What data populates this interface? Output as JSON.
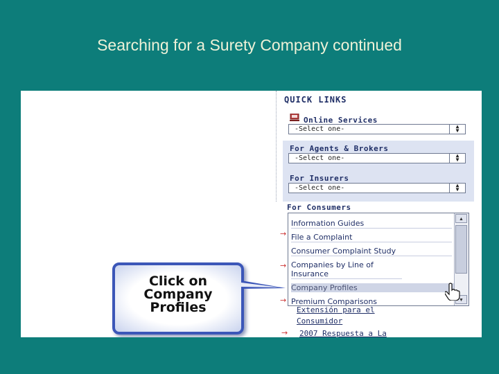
{
  "slide": {
    "title": "Searching for a Surety Company continued"
  },
  "quick_links": {
    "heading": "QUICK LINKS",
    "online_services": {
      "label": "Online Services",
      "selected": "-Select one-"
    },
    "agents_brokers": {
      "label": "For Agents & Brokers",
      "selected": "-Select one-"
    },
    "insurers": {
      "label": "For Insurers",
      "selected": "-Select one-"
    },
    "consumers": {
      "label": "For Consumers",
      "options": [
        "Information Guides",
        "File a Complaint",
        "Consumer Complaint Study",
        "Companies by Line of Insurance",
        "Company Profiles",
        "Premium Comparisons"
      ],
      "highlighted": "Company Profiles"
    }
  },
  "links_below": [
    "Extensión para el",
    "Consumidor",
    "2007 Respuesta a La"
  ],
  "callout": {
    "text": "Click on\nCompany\nProfiles"
  },
  "colors": {
    "background": "#0d7d7a",
    "title": "#eef2d8",
    "callout_border": "#3b56b8",
    "link": "#1f2e66"
  }
}
